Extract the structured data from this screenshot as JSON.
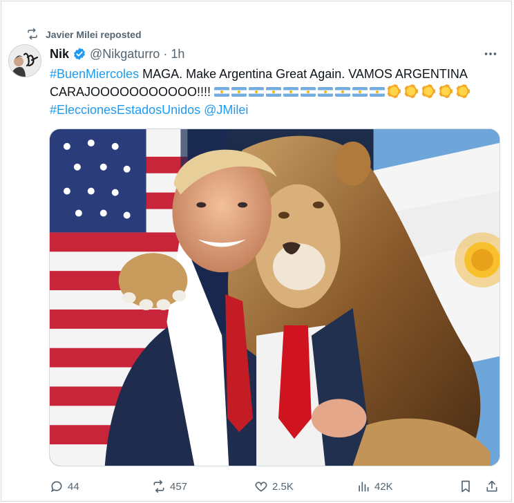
{
  "repost": {
    "text": "Javier Milei reposted",
    "icon": "repost-icon"
  },
  "author": {
    "name": "Nik",
    "handle": "@Nikgaturro",
    "separator": "·",
    "time": "1h",
    "verified": true
  },
  "tweet": {
    "hashtag1": "#BuenMiercoles",
    "line1_text": " MAGA. Make Argentina Great Again. VAMOS ARGENTINA",
    "line2_text": "CARAJOOOOOOOOOOO!!!! ",
    "flag_emoji_count": 10,
    "sun_emoji_count": 5,
    "hashtag2": "#EleccionesEstadosUnidos",
    "mention": "@JMilei"
  },
  "media": {
    "description_icon": "photo-icon"
  },
  "actions": {
    "replies": "44",
    "reposts": "457",
    "likes": "2.5K",
    "views": "42K"
  },
  "colors": {
    "link": "#1d9bf0",
    "secondary_text": "#536471",
    "primary_text": "#0f1419",
    "border": "#cfd9de"
  }
}
